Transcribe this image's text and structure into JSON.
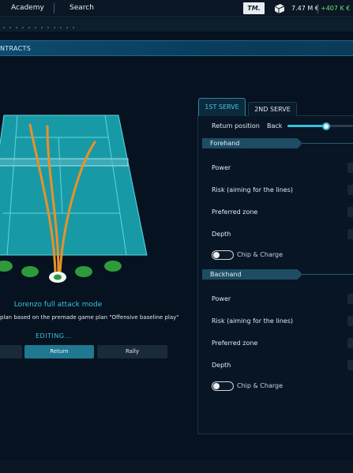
{
  "topbar": {
    "nav_academy": "Academy",
    "nav_search": "Search",
    "tm_badge": "TM.",
    "money": "7.47 M €",
    "money_delta": "+407 K €"
  },
  "banner": {
    "label": "NTRACTS"
  },
  "plan": {
    "title": "Lorenzo full attack mode",
    "subtitle": "plan based on the premade game plan \"Offensive baseline play\"",
    "editing": "EDITING...",
    "modes": [
      {
        "label": ""
      },
      {
        "label": "Return",
        "active": true
      },
      {
        "label": "Rally"
      }
    ]
  },
  "tabs": [
    {
      "label": "1ST SERVE",
      "active": true
    },
    {
      "label": "2ND SERVE",
      "active": false
    }
  ],
  "return_position": {
    "label": "Return position",
    "value": "Back",
    "level": 0.6
  },
  "forehand": {
    "title": "Forehand",
    "rows": [
      "Power",
      "Risk (aiming for the lines)",
      "Preferred zone",
      "Depth"
    ],
    "toggle_label": "Chip & Charge",
    "toggle_on": false
  },
  "backhand": {
    "title": "Backhand",
    "rows": [
      "Power",
      "Risk (aiming for the lines)",
      "Preferred zone",
      "Depth"
    ],
    "toggle_label": "Chip & Charge",
    "toggle_on": false
  },
  "colors": {
    "accent": "#39c3dd",
    "court": "#1a9aa8",
    "shot_path": "#e8912a",
    "target_zone": "#2e9b3a"
  }
}
